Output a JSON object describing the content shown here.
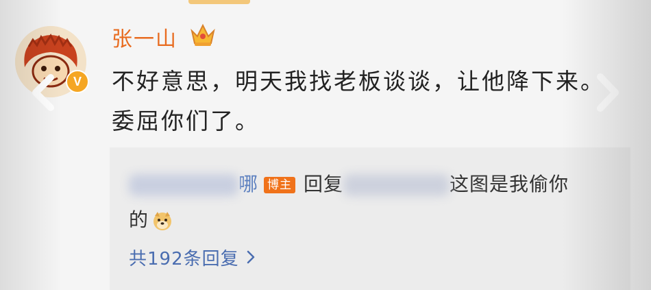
{
  "comment": {
    "username": "张一山",
    "verified_badge": "V",
    "text": "不好意思，明天我找老板谈谈，让他降下来。委屈你们了。"
  },
  "reply": {
    "author_name_tail": "哪",
    "author_badge": "博主",
    "reply_word": "回复",
    "text_part1": "这图是我偷你",
    "text_part2": "的",
    "emoji": "doge-emoji"
  },
  "footer": {
    "more_replies": "共192条回复"
  },
  "colors": {
    "username": "#e86b1f",
    "link": "#4a6db0",
    "badge": "#f0721a",
    "reply_bg": "#ececec"
  },
  "icons": [
    "crown-icon",
    "verified-icon",
    "chevron-left-icon",
    "chevron-right-icon",
    "chevron-right-small-icon"
  ]
}
